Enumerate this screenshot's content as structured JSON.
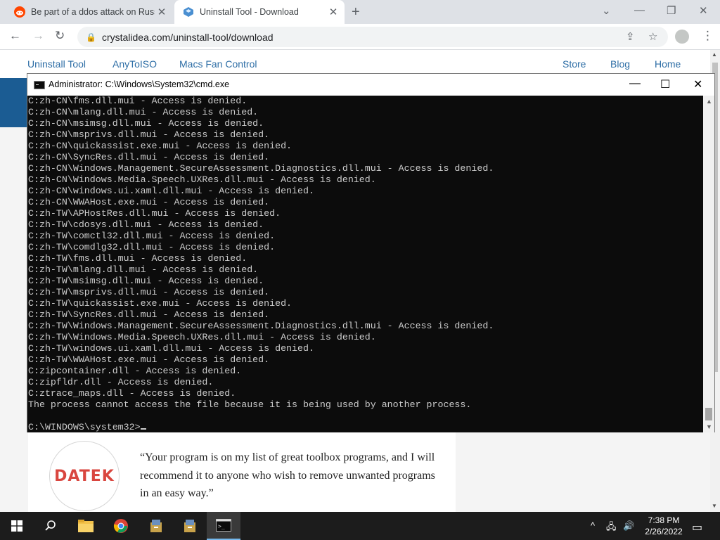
{
  "browser": {
    "tabs": [
      {
        "title": "Be part of a ddos attack on Russ",
        "close": "✕"
      },
      {
        "title": "Uninstall Tool - Download",
        "close": "✕"
      }
    ],
    "new_tab": "+",
    "window_controls": [
      "⌄",
      "—",
      "❐",
      "✕"
    ],
    "url": "crystalidea.com/uninstall-tool/download",
    "nav": {
      "back": "←",
      "forward": "→",
      "reload": "↻"
    },
    "omnibox_actions": {
      "share": "⇪",
      "star": "☆"
    },
    "menu": "⋮"
  },
  "site": {
    "nav": [
      "Uninstall Tool",
      "AnyToISO",
      "Macs Fan Control",
      "Store",
      "Blog",
      "Home"
    ],
    "testimonial": {
      "logo": "DATEK",
      "quote": "“Your program is on my list of great toolbox programs, and I will recommend it to anyone who wish to remove unwanted programs in an easy way.”"
    }
  },
  "cmd": {
    "title": "Administrator: C:\\Windows\\System32\\cmd.exe",
    "buttons": {
      "minimize": "—",
      "maximize": "☐",
      "close": "✕"
    },
    "lines": [
      "C:zh-CN\\fms.dll.mui - Access is denied.",
      "C:zh-CN\\mlang.dll.mui - Access is denied.",
      "C:zh-CN\\msimsg.dll.mui - Access is denied.",
      "C:zh-CN\\msprivs.dll.mui - Access is denied.",
      "C:zh-CN\\quickassist.exe.mui - Access is denied.",
      "C:zh-CN\\SyncRes.dll.mui - Access is denied.",
      "C:zh-CN\\Windows.Management.SecureAssessment.Diagnostics.dll.mui - Access is denied.",
      "C:zh-CN\\Windows.Media.Speech.UXRes.dll.mui - Access is denied.",
      "C:zh-CN\\windows.ui.xaml.dll.mui - Access is denied.",
      "C:zh-CN\\WWAHost.exe.mui - Access is denied.",
      "C:zh-TW\\APHostRes.dll.mui - Access is denied.",
      "C:zh-TW\\cdosys.dll.mui - Access is denied.",
      "C:zh-TW\\comctl32.dll.mui - Access is denied.",
      "C:zh-TW\\comdlg32.dll.mui - Access is denied.",
      "C:zh-TW\\fms.dll.mui - Access is denied.",
      "C:zh-TW\\mlang.dll.mui - Access is denied.",
      "C:zh-TW\\msimsg.dll.mui - Access is denied.",
      "C:zh-TW\\msprivs.dll.mui - Access is denied.",
      "C:zh-TW\\quickassist.exe.mui - Access is denied.",
      "C:zh-TW\\SyncRes.dll.mui - Access is denied.",
      "C:zh-TW\\Windows.Management.SecureAssessment.Diagnostics.dll.mui - Access is denied.",
      "C:zh-TW\\Windows.Media.Speech.UXRes.dll.mui - Access is denied.",
      "C:zh-TW\\windows.ui.xaml.dll.mui - Access is denied.",
      "C:zh-TW\\WWAHost.exe.mui - Access is denied.",
      "C:zipcontainer.dll - Access is denied.",
      "C:zipfldr.dll - Access is denied.",
      "C:ztrace_maps.dll - Access is denied.",
      "The process cannot access the file because it is being used by another process.",
      "",
      "C:\\WINDOWS\\system32>"
    ]
  },
  "taskbar": {
    "start": "⊞",
    "search": "⌕",
    "tray": {
      "chevron": "^",
      "network": "🖧",
      "volume": "🔊"
    },
    "time": "7:38 PM",
    "date": "2/26/2022",
    "notification": "▭"
  },
  "colors": {
    "console_bg": "#0c0c0c",
    "console_text": "#cccccc",
    "site_link": "#2e6ea6",
    "taskbar": "#1c1c1c"
  }
}
